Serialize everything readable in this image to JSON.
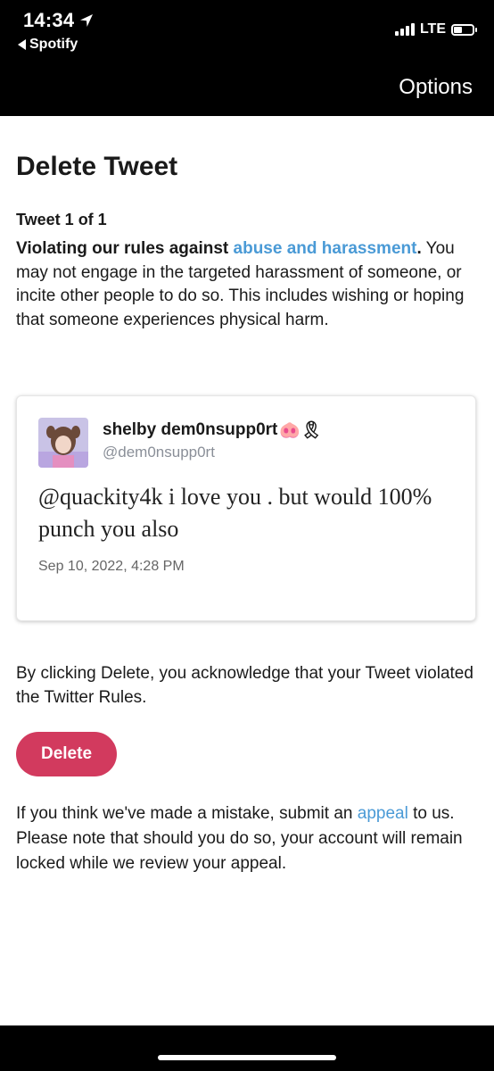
{
  "status_bar": {
    "time": "14:34",
    "back_app": "Spotify",
    "network": "LTE"
  },
  "nav": {
    "options_label": "Options"
  },
  "page": {
    "title": "Delete Tweet",
    "tweet_count": "Tweet 1 of 1",
    "rule_prefix": "Violating our rules against ",
    "rule_link": "abuse and harassment",
    "rule_suffix": ".",
    "rule_description": " You may not engage in the targeted harassment of someone, or incite other people to do so. This includes wishing or hoping that someone experiences physical harm."
  },
  "tweet": {
    "author_name": "shelby dem0nsupp0rt",
    "author_emoji": "🐽🎗",
    "handle": "@dem0nsupp0rt",
    "text": "@quackity4k i love you . but would 100% punch you also",
    "date": "Sep 10, 2022, 4:28 PM"
  },
  "acknowledgement": "By clicking Delete, you acknowledge that your Tweet violated the Twitter Rules.",
  "delete_label": "Delete",
  "appeal": {
    "prefix": "If you think we've made a mistake, submit an ",
    "link": "appeal",
    "suffix": " to us. Please note that should you do so, your account will remain locked while we review your appeal."
  },
  "colors": {
    "link": "#4a9ad6",
    "delete_button": "#d23a5e",
    "top_bar": "#000000"
  }
}
